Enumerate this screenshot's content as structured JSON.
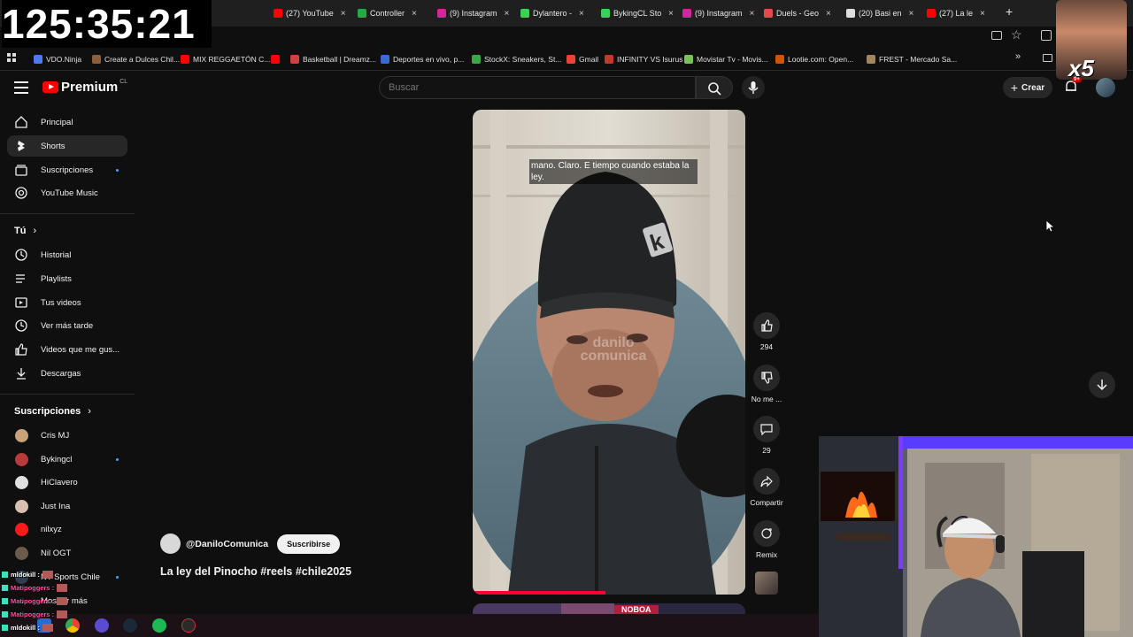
{
  "overlay": {
    "clock": "125:35:21",
    "meme_badge": "x5"
  },
  "browser": {
    "tabs": [
      {
        "title": "(27) YouTube",
        "color": "#ff0000"
      },
      {
        "title": "Controller",
        "color": "#22aa44"
      },
      {
        "title": "(9) Instagram",
        "color": "#d6249f"
      },
      {
        "title": "Dylantero -",
        "color": "#39d353"
      },
      {
        "title": "BykingCL Sto",
        "color": "#39d353"
      },
      {
        "title": "(9) Instagram",
        "color": "#d6249f"
      },
      {
        "title": "Duels - Geo",
        "color": "#e14b4b"
      },
      {
        "title": "(20) Basi en",
        "color": "#dddddd"
      },
      {
        "title": "(27) La le",
        "color": "#ff0000"
      }
    ],
    "new_tab": "+",
    "bookmarks": [
      {
        "title": "VDO.Ninja",
        "color": "#4b7bec"
      },
      {
        "title": "Create a Dulces Chil...",
        "color": "#8b5e3c"
      },
      {
        "title": "MIX REGGAETÓN C...",
        "color": "#ff0000"
      },
      {
        "title": "",
        "color": "#ff0000"
      },
      {
        "title": "Basketball | Dreamz...",
        "color": "#d04040"
      },
      {
        "title": "Deportes en vivo, p...",
        "color": "#3a6bd1"
      },
      {
        "title": "StockX: Sneakers, St...",
        "color": "#39a845"
      },
      {
        "title": "Gmail",
        "color": "#ea4335"
      },
      {
        "title": "INFINITY VS Isurus",
        "color": "#c0392b"
      },
      {
        "title": "Movistar Tv - Movis...",
        "color": "#78c257"
      },
      {
        "title": "Lootie.com: Open...",
        "color": "#d35400"
      },
      {
        "title": "FREST - Mercado Sa...",
        "color": "#a0865b"
      }
    ]
  },
  "header": {
    "logo_text": "Premium",
    "region": "CL",
    "search_placeholder": "Buscar",
    "create_label": "Crear",
    "notifications_badge": "9+"
  },
  "sidebar": {
    "main": [
      {
        "label": "Principal",
        "icon": "home-icon"
      },
      {
        "label": "Shorts",
        "icon": "shorts-icon"
      },
      {
        "label": "Suscripciones",
        "icon": "subscriptions-icon"
      },
      {
        "label": "YouTube Music",
        "icon": "music-icon"
      }
    ],
    "you_heading": "Tú",
    "you": [
      {
        "label": "Historial",
        "icon": "history-icon"
      },
      {
        "label": "Playlists",
        "icon": "playlists-icon"
      },
      {
        "label": "Tus videos",
        "icon": "your-videos-icon"
      },
      {
        "label": "Ver más tarde",
        "icon": "watch-later-icon"
      },
      {
        "label": "Videos que me gus...",
        "icon": "liked-icon"
      },
      {
        "label": "Descargas",
        "icon": "downloads-icon"
      }
    ],
    "subs_heading": "Suscripciones",
    "subs": [
      {
        "label": "Cris MJ",
        "color": "#c9a27a"
      },
      {
        "label": "Bykingcl",
        "color": "#b93a3a"
      },
      {
        "label": "HiClavero",
        "color": "#e0e0e0"
      },
      {
        "label": "Just Ina",
        "color": "#d8c0b0"
      },
      {
        "label": "nilxyz",
        "color": "#ff1a1a"
      },
      {
        "label": "Nil OGT",
        "color": "#6b5b4b"
      },
      {
        "label": "NT Sports Chile",
        "color": "#2c3e50"
      }
    ],
    "show_more": "Mostrar más"
  },
  "short": {
    "caption": "mano. Claro. E tiempo cuando estaba la ley.",
    "watermark": "danilo comunica",
    "channel": "@DaniloComunica",
    "subscribe_label": "Suscribirse",
    "title": "La ley del Pinocho #reels #chile2025",
    "next_banner": "NOBOA",
    "actions": {
      "like_count": "294",
      "dislike_label": "No me ...",
      "comments_count": "29",
      "share_label": "Compartir",
      "remix_label": "Remix"
    }
  },
  "chat": [
    {
      "user": "mldokill :",
      "color": "#ffffff"
    },
    {
      "user": "Matipoggers :",
      "color": "#ff4fa0"
    },
    {
      "user": "Matipoggers :",
      "color": "#ff4fa0"
    },
    {
      "user": "Matipoggers :",
      "color": "#ff4fa0"
    },
    {
      "user": "mldokill :",
      "color": "#ffffff"
    }
  ]
}
